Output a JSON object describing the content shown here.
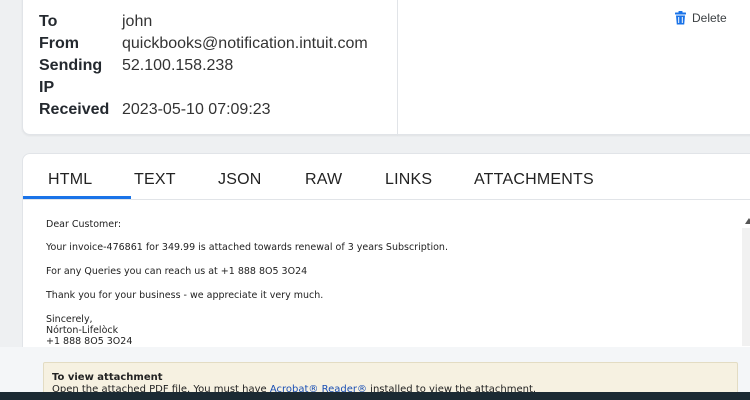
{
  "header": {
    "fields": [
      {
        "label": "To",
        "value": "john"
      },
      {
        "label": "From",
        "value": "quickbooks@notification.intuit.com"
      },
      {
        "label": "Sending IP",
        "value": "52.100.158.238"
      },
      {
        "label": "Received",
        "value": "2023-05-10 07:09:23"
      }
    ],
    "delete_label": "Delete"
  },
  "tabs": {
    "items": [
      "HTML",
      "TEXT",
      "JSON",
      "RAW",
      "LINKS",
      "ATTACHMENTS"
    ],
    "active": "HTML"
  },
  "message": {
    "lines": [
      "Dear Customer:",
      "Your invoice-476861 for 349.99 is attached towards renewal of 3 years Subscription.",
      "For any Queries you can reach us at +1 888 8O5 3O24",
      "Thank you for your business - we appreciate it very much.",
      "Sincerely,",
      "Nórton-Lifelòck",
      "+1 888 8O5 3O24"
    ]
  },
  "attachment_notice": {
    "title": "To view attachment",
    "text_before": "Open the attached PDF file. You must have ",
    "link_text": "Acrobat® Reader®",
    "text_after": " installed to view the attachment."
  },
  "colors": {
    "accent": "#1a73e8",
    "delete_icon": "#1a73e8",
    "notice_background": "#f6f1e1"
  }
}
